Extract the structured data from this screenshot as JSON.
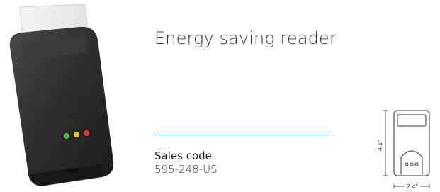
{
  "product": {
    "title": "Energy saving reader"
  },
  "sales": {
    "label": "Sales code",
    "code": "595-248-US"
  },
  "drawing": {
    "height_label": "4.1\"",
    "width_label": "2.4\""
  },
  "colors": {
    "accent_divider": "#3b9bc4",
    "device_body": "#2e2e2e",
    "led_green": "#4caf3a",
    "led_yellow": "#e5c21e",
    "led_red": "#d43a2c"
  },
  "icons": [
    "card-reader-photo",
    "dimension-drawing"
  ]
}
